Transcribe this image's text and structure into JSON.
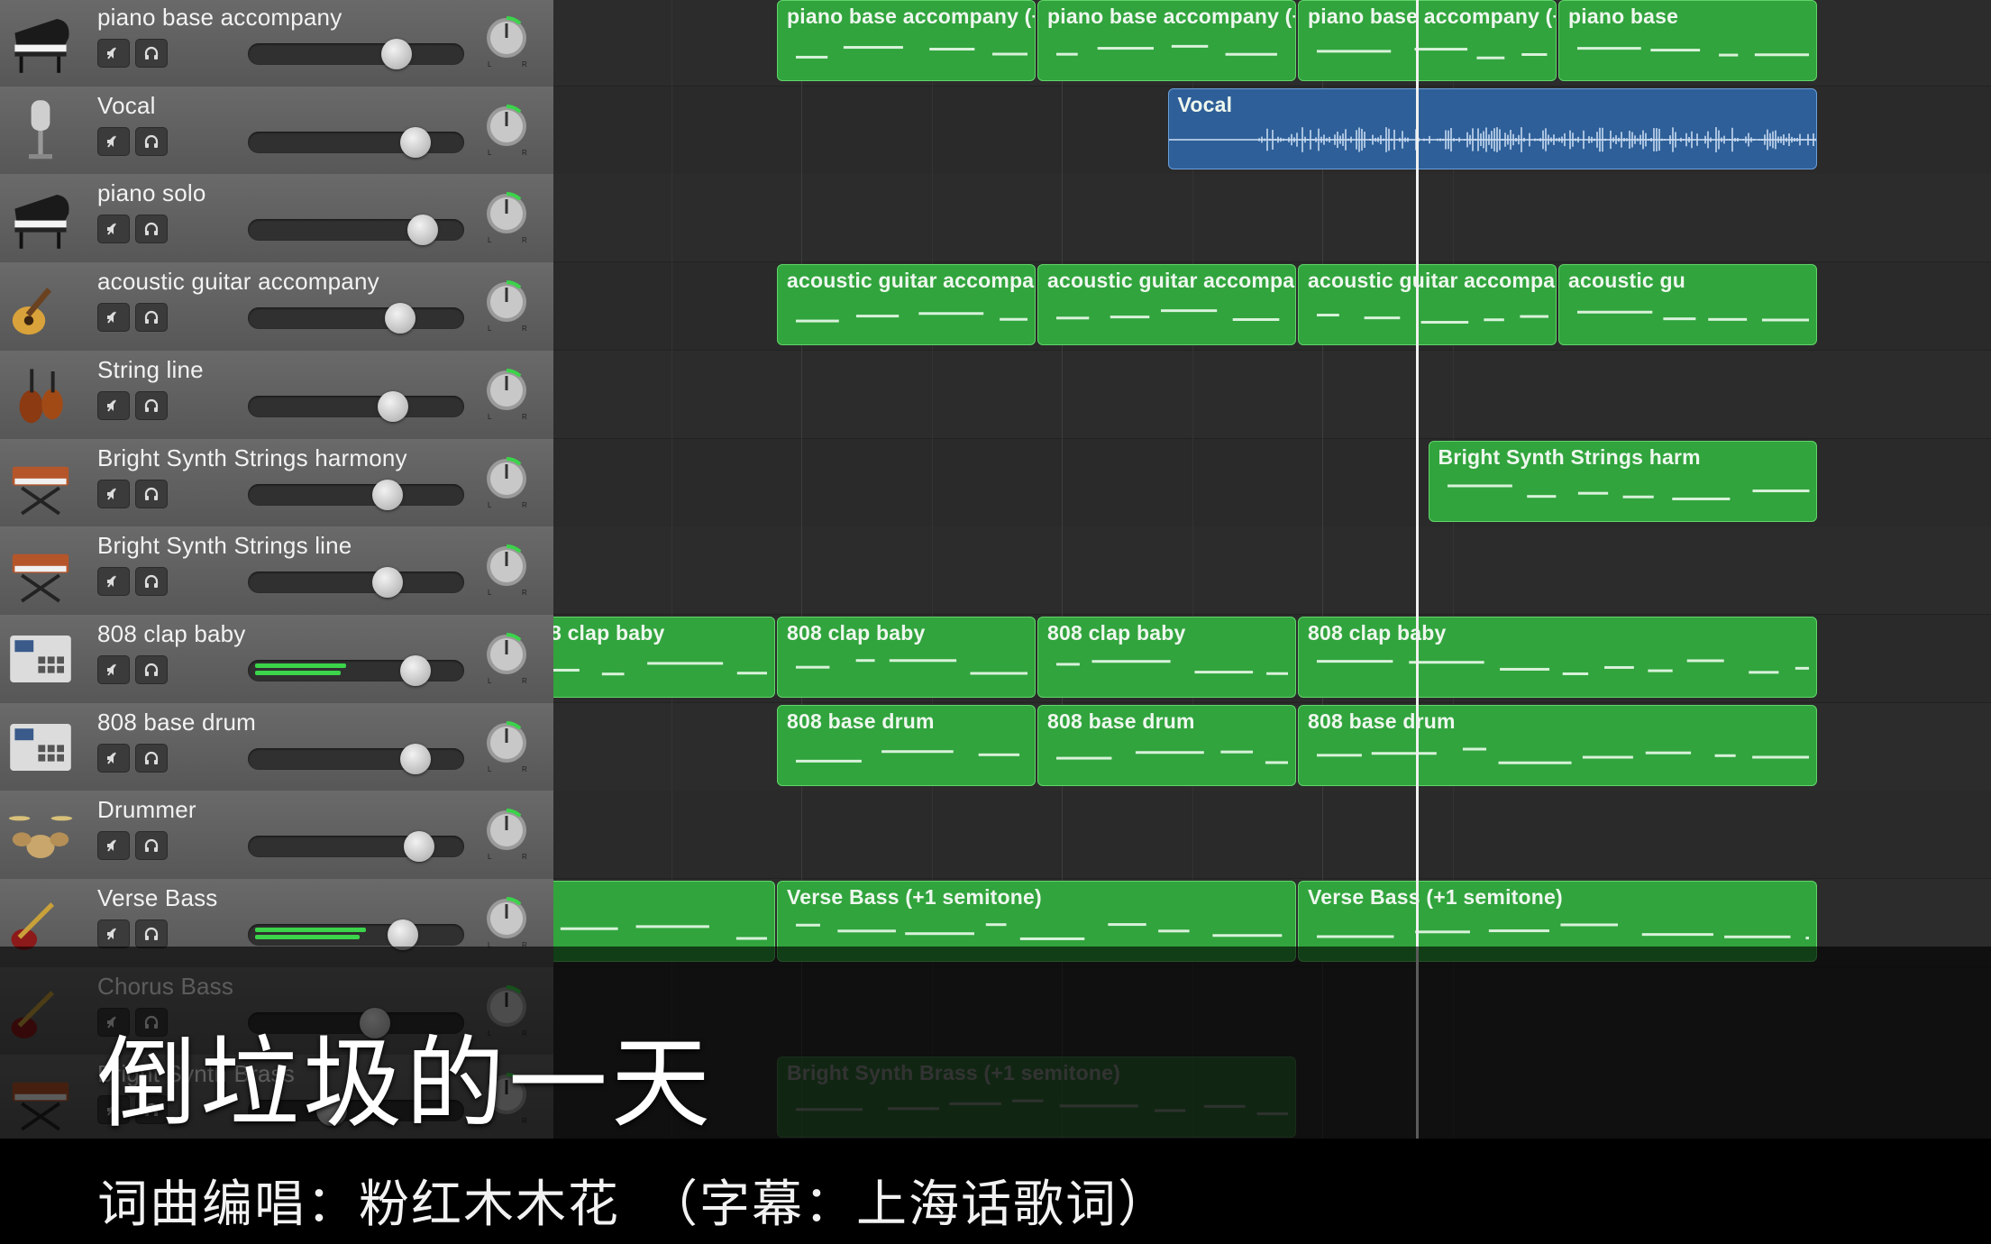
{
  "tracks": [
    {
      "name": "piano base accompany",
      "icon": "grand-piano-icon"
    },
    {
      "name": "Vocal",
      "icon": "microphone-icon"
    },
    {
      "name": "piano solo",
      "icon": "grand-piano-icon"
    },
    {
      "name": "acoustic guitar accompany",
      "icon": "acoustic-guitar-icon"
    },
    {
      "name": "String line",
      "icon": "string-instruments-icon"
    },
    {
      "name": "Bright Synth Strings harmony",
      "icon": "synthesizer-icon"
    },
    {
      "name": "Bright Synth Strings line",
      "icon": "synthesizer-icon"
    },
    {
      "name": "808 clap baby",
      "icon": "drum-machine-icon"
    },
    {
      "name": "808 base drum",
      "icon": "drum-machine-icon"
    },
    {
      "name": "Drummer",
      "icon": "drum-kit-icon"
    },
    {
      "name": "Verse Bass",
      "icon": "electric-bass-icon"
    },
    {
      "name": "Chorus Bass",
      "icon": "electric-bass-icon"
    },
    {
      "name": "Bright Synth Brass",
      "icon": "synthesizer-icon"
    }
  ],
  "faders": [
    0.72,
    0.82,
    0.86,
    0.74,
    0.7,
    0.67,
    0.67,
    0.82,
    0.82,
    0.84,
    0.75,
    0.6,
    0.37
  ],
  "meters": [
    0,
    0,
    0,
    0,
    0,
    0,
    0,
    0.45,
    0,
    0,
    0.55,
    0,
    0
  ],
  "regions": [
    {
      "track": 0,
      "name": "piano base accompany (+",
      "start": 0,
      "len": 1
    },
    {
      "track": 0,
      "name": "piano base accompany (+",
      "start": 1,
      "len": 1
    },
    {
      "track": 0,
      "name": "piano base accompany (+",
      "start": 2,
      "len": 1
    },
    {
      "track": 0,
      "name": "piano base",
      "start": 3,
      "len": 1
    },
    {
      "track": 1,
      "name": "Vocal",
      "start": 1.5,
      "len": 2.5,
      "audio": true
    },
    {
      "track": 3,
      "name": "acoustic guitar accompan",
      "start": 0,
      "len": 1
    },
    {
      "track": 3,
      "name": "acoustic guitar accompan",
      "start": 1,
      "len": 1
    },
    {
      "track": 3,
      "name": "acoustic guitar accompan",
      "start": 2,
      "len": 1
    },
    {
      "track": 3,
      "name": "acoustic gu",
      "start": 3,
      "len": 1
    },
    {
      "track": 5,
      "name": "Bright Synth Strings harm",
      "start": 2.5,
      "len": 1.5
    },
    {
      "track": 7,
      "name": "808 clap baby",
      "start": -2,
      "len": 1
    },
    {
      "track": 7,
      "name": "808 clap baby",
      "start": -1,
      "len": 1
    },
    {
      "track": 7,
      "name": "808 clap baby",
      "start": 0,
      "len": 1
    },
    {
      "track": 7,
      "name": "808 clap baby",
      "start": 1,
      "len": 1
    },
    {
      "track": 7,
      "name": "808 clap baby",
      "start": 2,
      "len": 2
    },
    {
      "track": 8,
      "name": "808 base drum",
      "start": 0,
      "len": 1
    },
    {
      "track": 8,
      "name": "808 base drum",
      "start": 1,
      "len": 1
    },
    {
      "track": 8,
      "name": "808 base drum",
      "start": 2,
      "len": 2
    },
    {
      "track": 10,
      "name": "Verse Bass (+1 semitone)",
      "start": -2,
      "len": 2
    },
    {
      "track": 10,
      "name": "Verse Bass (+1 semitone)",
      "start": 0,
      "len": 2
    },
    {
      "track": 10,
      "name": "Verse Bass (+1 semitone)",
      "start": 2,
      "len": 2
    },
    {
      "track": 12,
      "name": "Bright Synth Brass (+1 semitone)",
      "start": 0,
      "len": 2
    }
  ],
  "subtitle": {
    "title": "倒垃圾的一天",
    "credits": "词曲编唱：粉红木木花　（字幕：上海话歌词）"
  },
  "colors": {
    "midi_region": "#31a43d",
    "audio_region": "#2e5f98",
    "meter": "#3bd44a"
  }
}
